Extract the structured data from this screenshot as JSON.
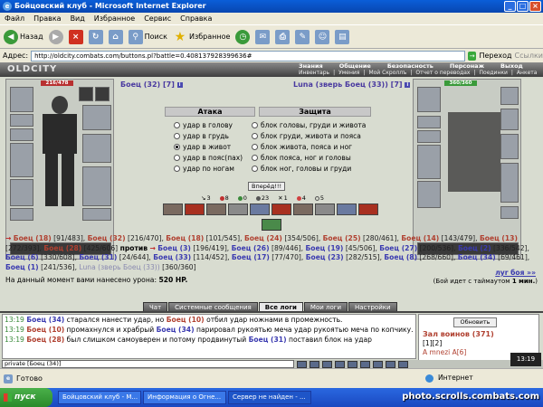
{
  "window": {
    "title": "Бойцовский клуб - Microsoft Internet Explorer"
  },
  "menu": [
    "Файл",
    "Правка",
    "Вид",
    "Избранное",
    "Сервис",
    "Справка"
  ],
  "toolbar": {
    "back": "Назад",
    "search": "Поиск",
    "favorites": "Избранное"
  },
  "address": {
    "label": "Адрес:",
    "url": "http://oldcity.combats.com/buttons.pl?battle=0.408137928399636#",
    "go": "Переход",
    "links": "Ссылки"
  },
  "game": {
    "logo": "OLDCITY",
    "nav": [
      "Знания",
      "Общение",
      "Безопасность",
      "Персонаж",
      "Выход"
    ],
    "subnav": [
      "Инвентарь",
      "Умения",
      "Мой Скроллъ",
      "Отчет о переводах",
      "Поединки",
      "Анкета"
    ]
  },
  "player": {
    "name": "Боец (32) [7]",
    "hp": "216/478"
  },
  "enemy": {
    "name": "Luna (зверь Боец (33)) [7]",
    "hp": "360/360"
  },
  "attack": {
    "title": "Атака",
    "options": [
      "удар в голову",
      "удар в грудь",
      "удар в живот",
      "удар в пояс(пах)",
      "удар по ногам"
    ],
    "selected": 2
  },
  "defense": {
    "title": "Защита",
    "options": [
      "блок головы, груди и живота",
      "блок груди, живота и пояса",
      "блок живота, пояса и ног",
      "блок пояса, ног и головы",
      "блок ног, головы и груди"
    ]
  },
  "forward_button": "Вперёд!!!",
  "stats": [
    "3",
    "8",
    "0",
    "23",
    "1",
    "4",
    "5"
  ],
  "fight": {
    "left": [
      {
        "n": "Боец (18)",
        "h": "[91/483]"
      },
      {
        "n": "Боец (32)",
        "h": "[216/470]"
      },
      {
        "n": "Боец (18)",
        "h": "[101/545]"
      },
      {
        "n": "Боец (24)",
        "h": "[354/506]"
      },
      {
        "n": "Боец (25)",
        "h": "[280/461]"
      },
      {
        "n": "Боец (14)",
        "h": "[143/479]"
      },
      {
        "n": "Боец (13)",
        "h": "[272/393]"
      },
      {
        "n": "Боец (28)",
        "h": "[425/606]"
      }
    ],
    "vs": "против",
    "right": [
      {
        "n": "Боец (3)",
        "h": "[196/419]"
      },
      {
        "n": "Боец (26)",
        "h": "[89/446]"
      },
      {
        "n": "Боец (19)",
        "h": "[45/506]"
      },
      {
        "n": "Боец (27)",
        "h": "[200/536]"
      },
      {
        "n": "Боец (2)",
        "h": "[336/542]"
      },
      {
        "n": "Боец (6)",
        "h": "[330/608]"
      },
      {
        "n": "Боец (31)",
        "h": "[24/644]"
      },
      {
        "n": "Боец (33)",
        "h": "[114/452]"
      },
      {
        "n": "Боец (17)",
        "h": "[77/470]"
      },
      {
        "n": "Боец (23)",
        "h": "[282/515]"
      },
      {
        "n": "Боец (8)",
        "h": "[268/660]"
      },
      {
        "n": "Боец (34)",
        "h": "[69/461]"
      },
      {
        "n": "Боец (1)",
        "h": "[241/536]"
      }
    ],
    "pet": "Luna (зверь Боец (33))",
    "pet_hp": "[360/360]"
  },
  "damage": {
    "text": "На данный момент вами нанесено урона:",
    "value": "520 HP."
  },
  "next_fight": "луr боя »»",
  "timeout": {
    "pre": "(Бой идет с таймаутом",
    "value": "1 мин.",
    "post": ")"
  },
  "tabs": [
    "Чат",
    "Системные сообщения",
    "Все логи",
    "Мои логи",
    "Настройки"
  ],
  "log": [
    {
      "t": "13:19",
      "a": "Боец (34)",
      "text": "старался нанести удар, но",
      "b": "Боец (10)",
      "rest": "отбил удар ножнами в промежность."
    },
    {
      "t": "13:19",
      "a": "Боец (10)",
      "text": "промахнулся и храбрый",
      "b": "Боец (34)",
      "rest": "парировал рукоятью меча удар рукоятью меча по копчику."
    },
    {
      "t": "13:19",
      "a": "Боец (28)",
      "text": "был слишком самоуверен и потому продвинутый",
      "b": "Боец (31)",
      "rest": "поставил блок на удар"
    }
  ],
  "side": {
    "refresh": "Обновить",
    "room": "Зал воинов (371)",
    "pages": "[1][2]",
    "member": "A mnezi A[6]"
  },
  "chat_input": "private [Боец (34)]",
  "clock": "13:19",
  "status": {
    "ready": "Готово",
    "zone": "Интернет"
  },
  "taskbar": {
    "start": "пуск",
    "tasks": [
      "Бойцовский клуб - M...",
      "Информация о Огне...",
      "Сервер не найден - ..."
    ]
  },
  "watermark": "photo.scrolls.combats.com"
}
